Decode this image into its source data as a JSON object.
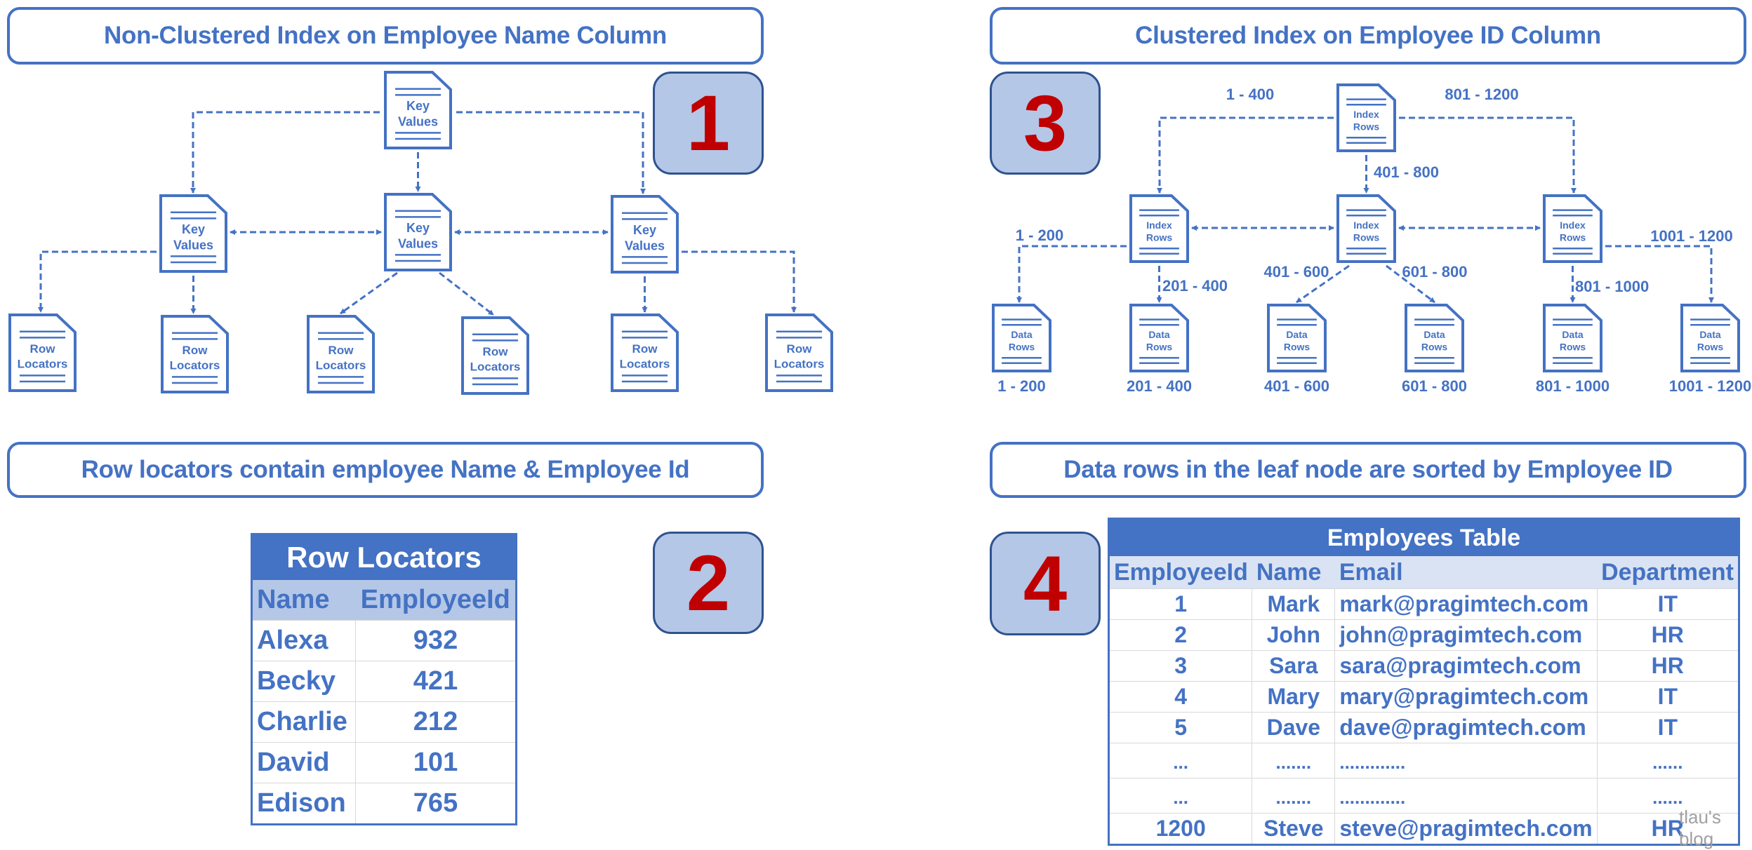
{
  "panels": {
    "top_left_title": "Non-Clustered Index on Employee Name Column",
    "top_right_title": "Clustered Index on Employee ID Column",
    "bottom_left_title": "Row locators contain employee Name & Employee Id",
    "bottom_right_title": "Data rows in the leaf node are sorted by Employee ID",
    "step_numbers": [
      "1",
      "2",
      "3",
      "4"
    ]
  },
  "nonclustered_tree": {
    "root": {
      "line1": "Key",
      "line2": "Values"
    },
    "intermediate": [
      {
        "line1": "Key",
        "line2": "Values"
      },
      {
        "line1": "Key",
        "line2": "Values"
      },
      {
        "line1": "Key",
        "line2": "Values"
      }
    ],
    "leaves": [
      {
        "line1": "Row",
        "line2": "Locators"
      },
      {
        "line1": "Row",
        "line2": "Locators"
      },
      {
        "line1": "Row",
        "line2": "Locators"
      },
      {
        "line1": "Row",
        "line2": "Locators"
      },
      {
        "line1": "Row",
        "line2": "Locators"
      },
      {
        "line1": "Row",
        "line2": "Locators"
      }
    ]
  },
  "clustered_tree": {
    "root": {
      "line1": "Index",
      "line2": "Rows"
    },
    "root_edge_labels": [
      "1 - 400",
      "401 - 800",
      "801 - 1200"
    ],
    "intermediate": [
      {
        "line1": "Index",
        "line2": "Rows"
      },
      {
        "line1": "Index",
        "line2": "Rows"
      },
      {
        "line1": "Index",
        "line2": "Rows"
      }
    ],
    "intermediate_edge_labels": [
      "1 - 200",
      "201 - 400",
      "401 - 600",
      "601 - 800",
      "801 - 1000",
      "1001 - 1200"
    ],
    "leaves": [
      {
        "line1": "Data",
        "line2": "Rows",
        "range": "1 - 200"
      },
      {
        "line1": "Data",
        "line2": "Rows",
        "range": "201 - 400"
      },
      {
        "line1": "Data",
        "line2": "Rows",
        "range": "401 - 600"
      },
      {
        "line1": "Data",
        "line2": "Rows",
        "range": "601 - 800"
      },
      {
        "line1": "Data",
        "line2": "Rows",
        "range": "801 - 1000"
      },
      {
        "line1": "Data",
        "line2": "Rows",
        "range": "1001 - 1200"
      }
    ]
  },
  "row_locators_table": {
    "title": "Row Locators",
    "columns": [
      "Name",
      "EmployeeId"
    ],
    "rows": [
      [
        "Alexa",
        "932"
      ],
      [
        "Becky",
        "421"
      ],
      [
        "Charlie",
        "212"
      ],
      [
        "David",
        "101"
      ],
      [
        "Edison",
        "765"
      ]
    ]
  },
  "employees_table": {
    "title": "Employees Table",
    "columns": [
      "EmployeeId",
      "Name",
      "Email",
      "Department"
    ],
    "rows": [
      [
        "1",
        "Mark",
        "mark@pragimtech.com",
        "IT"
      ],
      [
        "2",
        "John",
        "john@pragimtech.com",
        "HR"
      ],
      [
        "3",
        "Sara",
        "sara@pragimtech.com",
        "HR"
      ],
      [
        "4",
        "Mary",
        "mary@pragimtech.com",
        "IT"
      ],
      [
        "5",
        "Dave",
        "dave@pragimtech.com",
        "IT"
      ],
      [
        "...",
        ".......",
        ".............",
        "......"
      ],
      [
        "...",
        ".......",
        ".............",
        "......"
      ],
      [
        "1200",
        "Steve",
        "steve@pragimtech.com",
        "HR"
      ]
    ]
  },
  "watermark": "tlau's blog",
  "colors": {
    "primary_blue": "#4472C4",
    "step_box_fill": "#B4C7E7",
    "step_number_red": "#C00000",
    "header_light": "#DAE3F3"
  }
}
